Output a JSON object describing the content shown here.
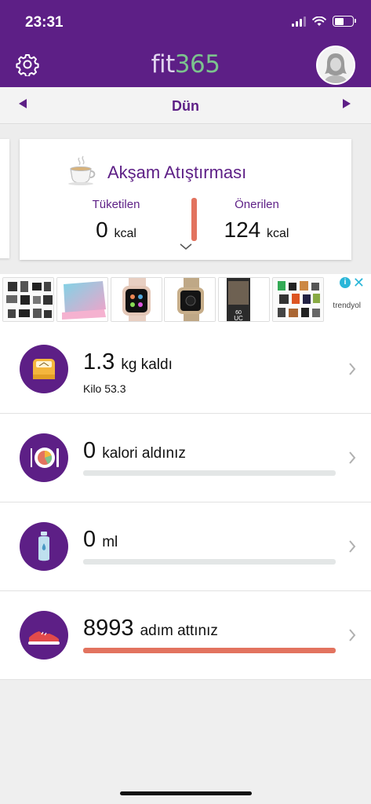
{
  "status": {
    "time": "23:31"
  },
  "header": {
    "logo_a": "fit",
    "logo_b": "365",
    "icons": [
      "gear-icon",
      "avatar"
    ]
  },
  "date_nav": {
    "label": "Dün"
  },
  "meal_card": {
    "title": "Akşam Atıştırması",
    "consumed_label": "Tüketilen",
    "consumed_value": "0",
    "recommended_label": "Önerilen",
    "recommended_value": "124",
    "unit": "kcal"
  },
  "ad": {
    "brand": "trendyol",
    "info": "i",
    "close": "✕"
  },
  "rows": [
    {
      "icon": "scale-icon",
      "value": "1.3",
      "unit": "kg kaldı",
      "sub": "Kilo 53.3"
    },
    {
      "icon": "plate-icon",
      "value": "0",
      "unit": "kalori aldınız",
      "progress": 0
    },
    {
      "icon": "water-bottle-icon",
      "value": "0",
      "unit": "ml",
      "progress": 0
    },
    {
      "icon": "sneaker-icon",
      "value": "8993",
      "unit": "adım attınız",
      "progress": 1
    }
  ],
  "colors": {
    "brand": "#5d1f86",
    "accent": "#e2735f",
    "logo_green": "#7cc38e"
  }
}
